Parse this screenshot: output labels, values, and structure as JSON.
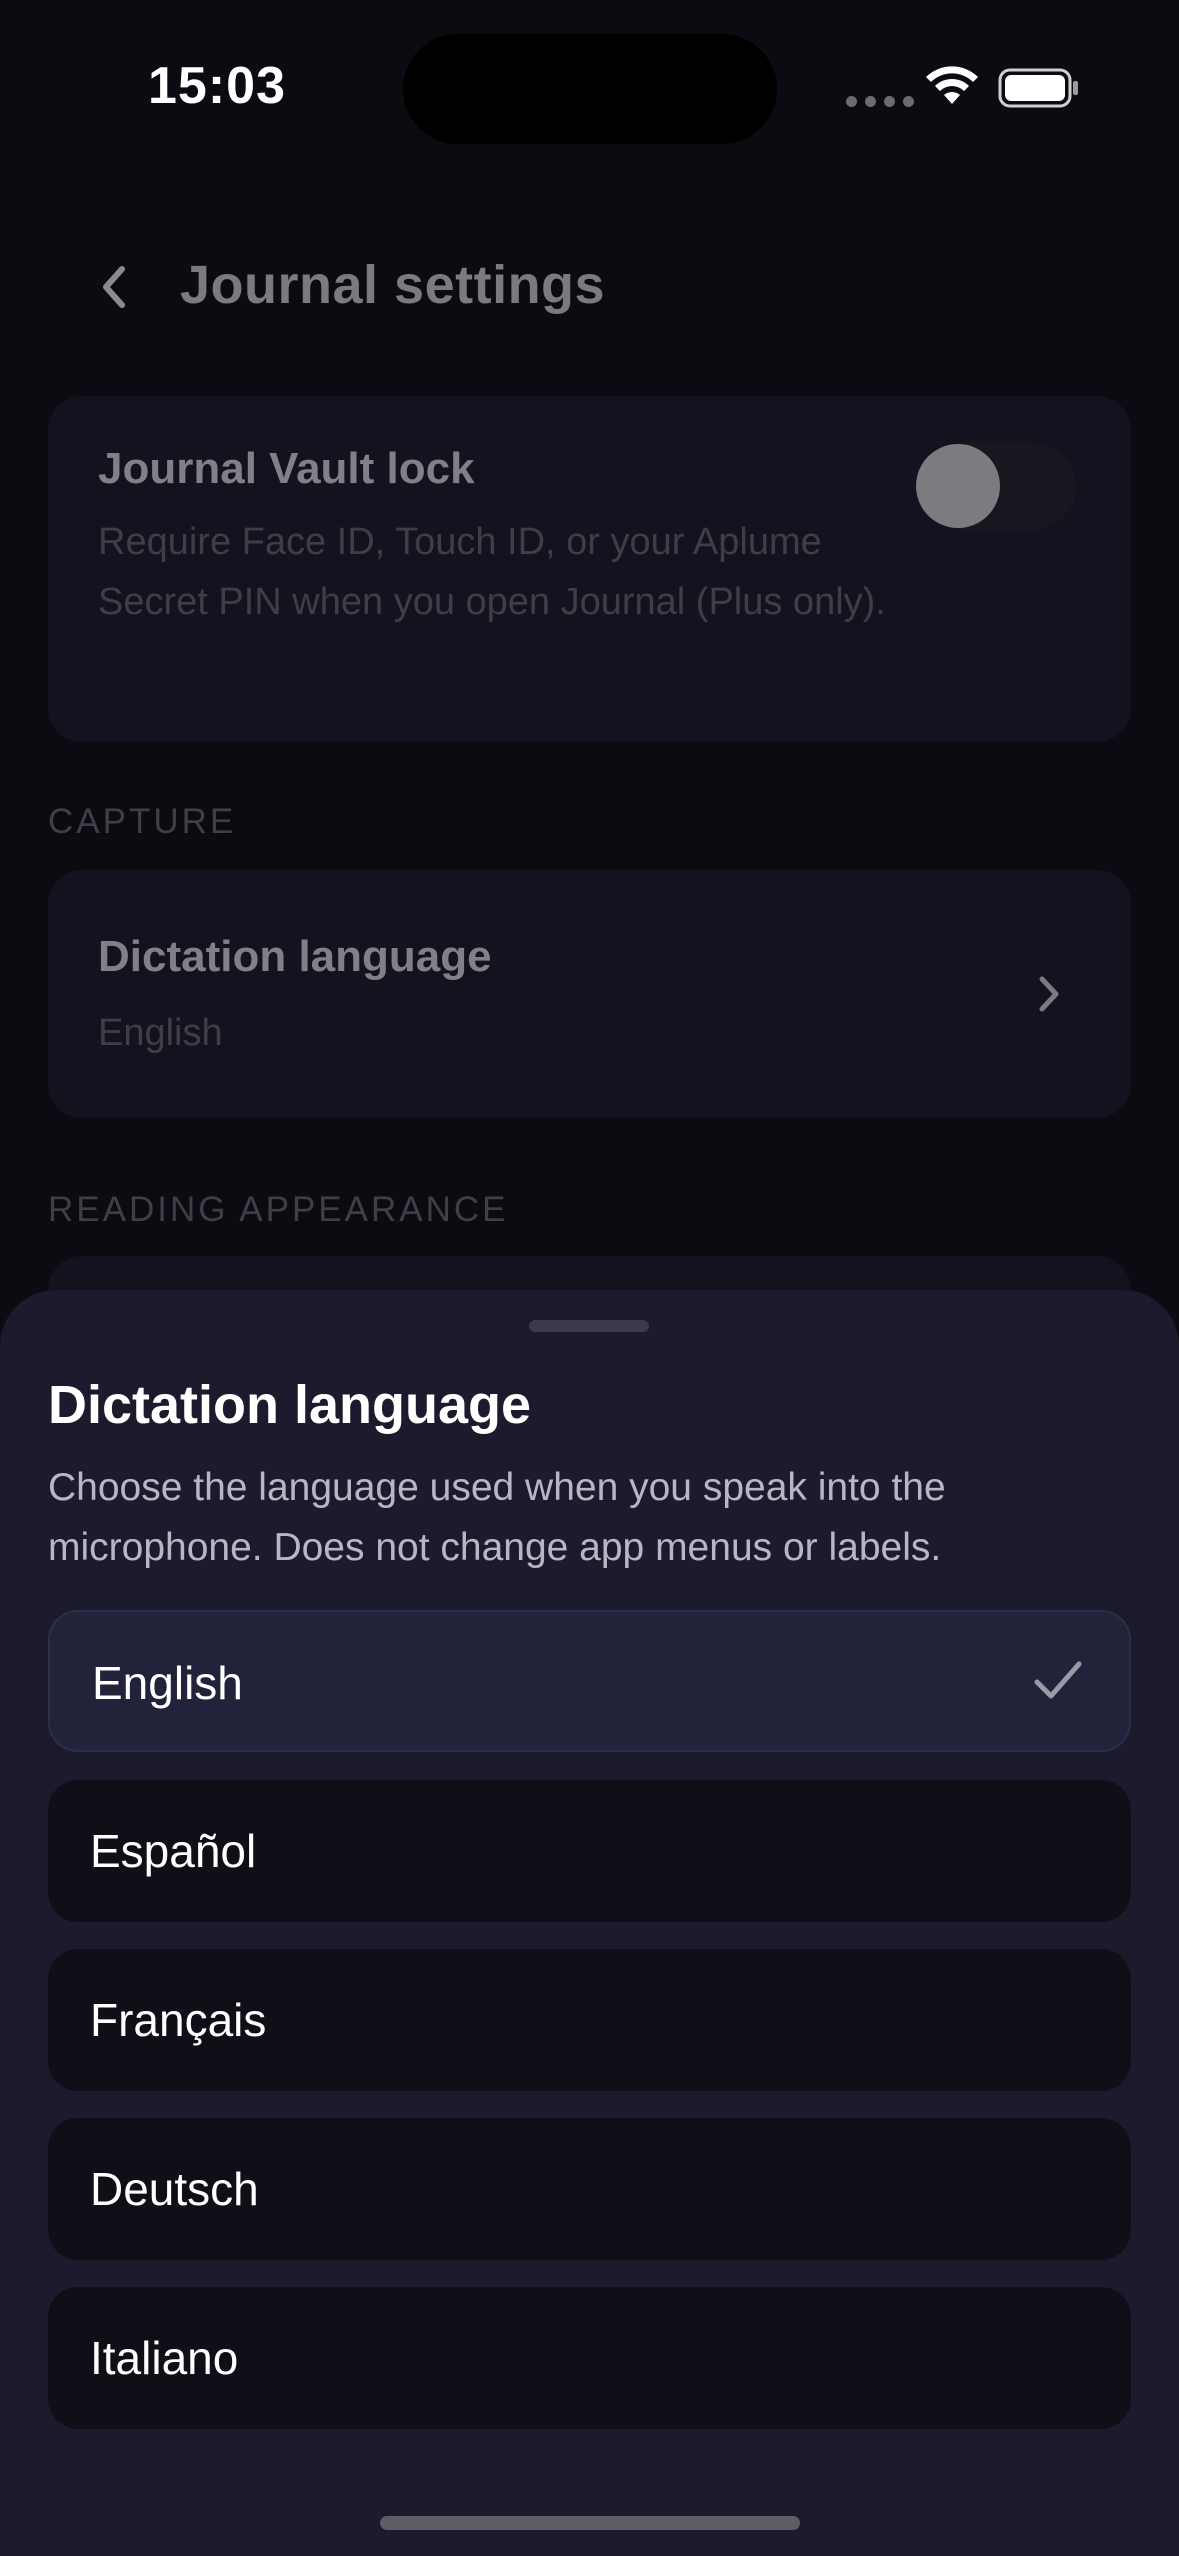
{
  "status_bar": {
    "time": "15:03"
  },
  "header": {
    "title": "Journal settings"
  },
  "vault": {
    "title": "Journal Vault lock",
    "description": "Require Face ID, Touch ID, or your Aplume Secret PIN when you open Journal (Plus only).",
    "enabled": false
  },
  "capture": {
    "section_label": "CAPTURE",
    "dictation_title": "Dictation language",
    "dictation_value": "English"
  },
  "reading": {
    "section_label": "READING APPEARANCE"
  },
  "sheet": {
    "title": "Dictation language",
    "description": "Choose the language used when you speak into the microphone. Does not change app menus or labels.",
    "options": [
      {
        "label": "English",
        "selected": true
      },
      {
        "label": "Español",
        "selected": false
      },
      {
        "label": "Français",
        "selected": false
      },
      {
        "label": "Deutsch",
        "selected": false
      },
      {
        "label": "Italiano",
        "selected": false
      }
    ]
  },
  "colors": {
    "background": "#0b0b11",
    "sheet": "#1b1b2d",
    "selected_option": "#22223a",
    "option": "#0f0f18"
  }
}
